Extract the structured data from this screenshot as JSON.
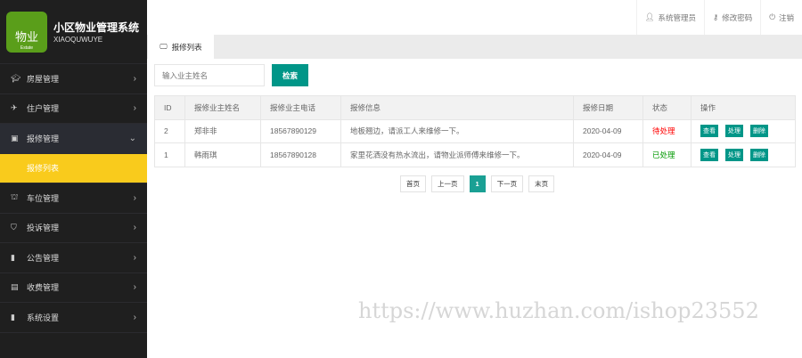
{
  "app": {
    "logo_text": "物业",
    "logo_sub": "Estate",
    "title": "小区物业管理系统",
    "subtitle": "XIAOQUWUYE"
  },
  "sidebar": {
    "items": [
      {
        "label": "房屋管理",
        "icon": "graduation-cap-icon"
      },
      {
        "label": "住户管理",
        "icon": "rocket-icon"
      },
      {
        "label": "报修管理",
        "icon": "repair-icon"
      },
      {
        "label": "报修列表"
      },
      {
        "label": "车位管理",
        "icon": "bag-icon"
      },
      {
        "label": "投诉管理",
        "icon": "shield-icon"
      },
      {
        "label": "公告管理",
        "icon": "bar-chart-icon"
      },
      {
        "label": "收费管理",
        "icon": "wallet-icon"
      },
      {
        "label": "系统设置",
        "icon": "bar-chart-icon"
      }
    ]
  },
  "header": {
    "user": "系统管理员",
    "password": "修改密码",
    "logout": "注销"
  },
  "tab": {
    "label": "报修列表"
  },
  "search": {
    "placeholder": "输入业主姓名",
    "button": "检索"
  },
  "table": {
    "headers": [
      "ID",
      "报修业主姓名",
      "报修业主电话",
      "报修信息",
      "报修日期",
      "状态",
      "操作"
    ],
    "rows": [
      {
        "id": "2",
        "name": "郑非非",
        "phone": "18567890129",
        "info": "地板翘边，请派工人来维修一下。",
        "date": "2020-04-09",
        "status": "待处理",
        "status_color": "#ff0000"
      },
      {
        "id": "1",
        "name": "韩雨琪",
        "phone": "18567890128",
        "info": "家里花洒没有热水流出，请物业派师傅来维修一下。",
        "date": "2020-04-09",
        "status": "已处理",
        "status_color": "#009900"
      }
    ],
    "actions": [
      "查看",
      "处理",
      "删除"
    ]
  },
  "pager": {
    "first": "首页",
    "prev": "上一页",
    "current": "1",
    "next": "下一页",
    "last": "末页"
  },
  "watermark": "https://www.huzhan.com/ishop23552"
}
